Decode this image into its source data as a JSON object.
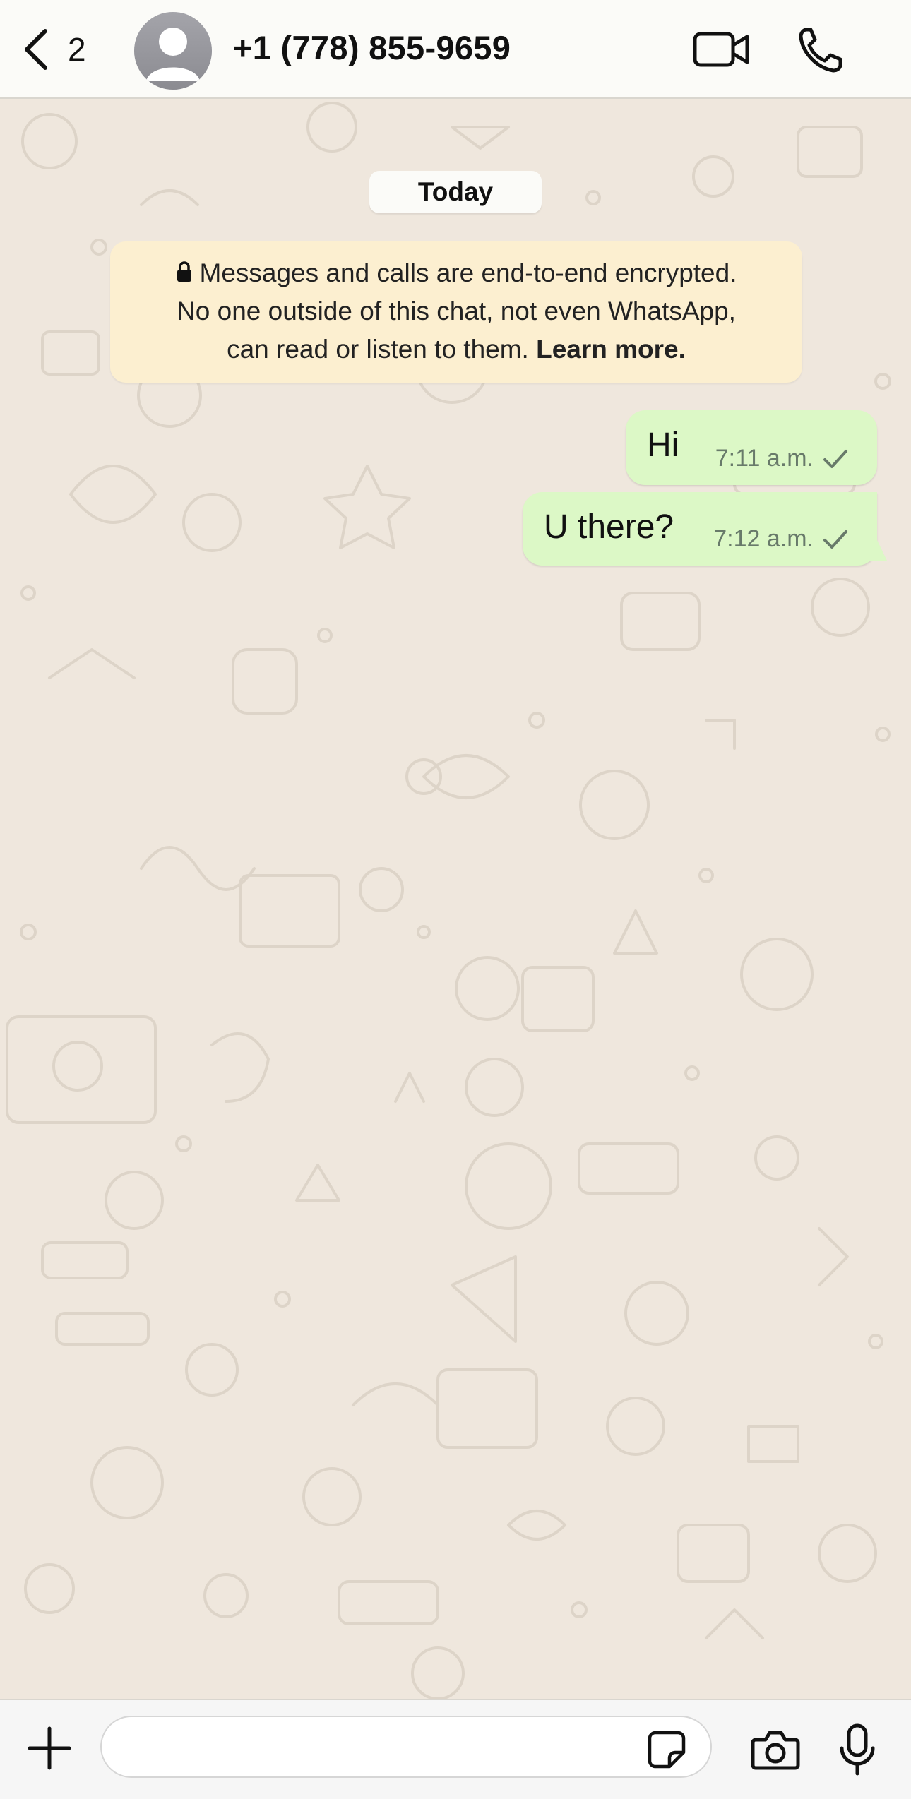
{
  "header": {
    "back_count": "2",
    "contact_name": "+1 (778) 855-9659",
    "icons": [
      "chevron-left-icon",
      "avatar-placeholder",
      "video-call-icon",
      "phone-call-icon"
    ]
  },
  "chat": {
    "date_chip": "Today",
    "encryption_notice": {
      "line1": "Messages and calls are end-to-end encrypted.",
      "line2": "No one outside of this chat, not even WhatsApp,",
      "line3": "can read or listen to them.",
      "link": "Learn more."
    },
    "messages": [
      {
        "text": "Hi",
        "time": "7:11 a.m.",
        "status": "sent",
        "direction": "outgoing"
      },
      {
        "text": "U there?",
        "time": "7:12 a.m.",
        "status": "sent",
        "direction": "outgoing"
      }
    ]
  },
  "composer": {
    "placeholder": "",
    "icons": [
      "plus-icon",
      "sticker-icon",
      "camera-icon",
      "microphone-icon"
    ]
  },
  "colors": {
    "header_bg": "#fbfbf8",
    "chat_bg": "#efe7dd",
    "outgoing_bubble": "#dcf8c6",
    "notice_bg": "#fcefd0",
    "meta_text": "#687a6a"
  }
}
